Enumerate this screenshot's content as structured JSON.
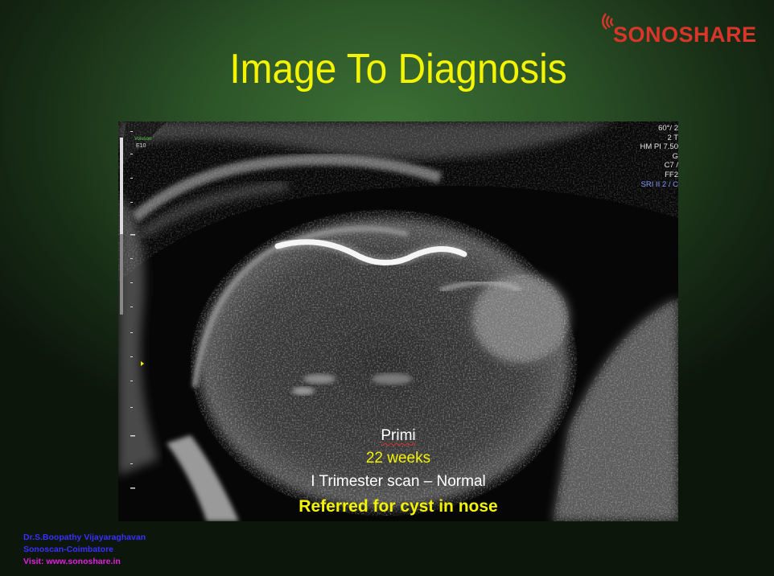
{
  "brand": {
    "logo_text": "SONOSHARE",
    "logo_icon": "signal-waves-icon",
    "color": "#d8352b"
  },
  "slide": {
    "title": "Image To Diagnosis",
    "title_color": "#f4f400"
  },
  "scanner_readout": {
    "line1": "60°/ 2",
    "line2": "2 T",
    "line3": "HM PI 7.50",
    "line4": "G",
    "line5": "C7 /",
    "line6": "FF2",
    "line7": "SRI II 2 / C"
  },
  "scanner_labels": {
    "voluson": "Voluson",
    "model": "E10"
  },
  "case": {
    "parity": "Primi",
    "gestation": "22 weeks",
    "prior_scan": "I Trimester scan – Normal",
    "referral": "Referred for cyst in nose"
  },
  "credits": {
    "name": "Dr.S.Boopathy Vijayaraghavan",
    "place": "Sonoscan-Coimbatore",
    "visit": "Visit: www.sonoshare.in"
  },
  "colors": {
    "caption_white": "#ffffff",
    "caption_yellow": "#f4f400",
    "credit_blue": "#3a30ff",
    "credit_magenta": "#e020e0"
  }
}
